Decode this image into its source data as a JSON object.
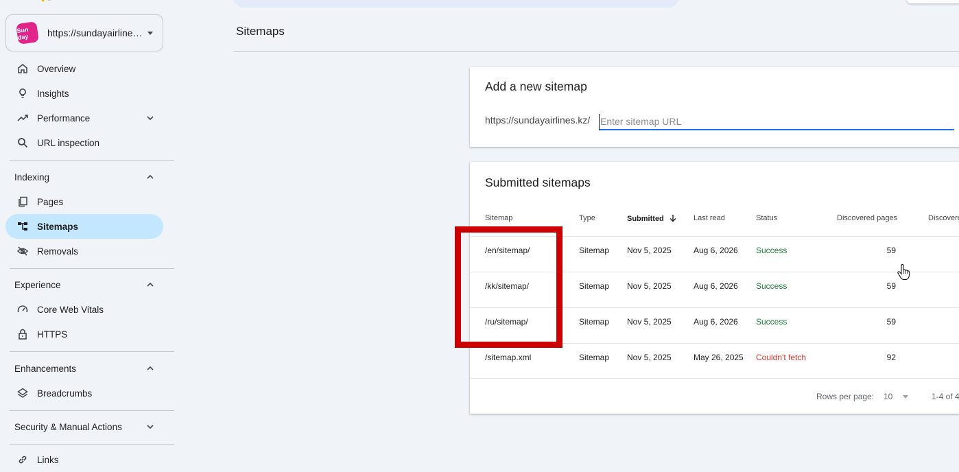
{
  "property": {
    "url": "https://sundayairlines.kz/",
    "avatar_text": "Sun day"
  },
  "nav": {
    "overview": "Overview",
    "insights": "Insights",
    "performance": "Performance",
    "url_inspection": "URL inspection",
    "indexing": "Indexing",
    "pages": "Pages",
    "sitemaps": "Sitemaps",
    "removals": "Removals",
    "experience": "Experience",
    "core_web_vitals": "Core Web Vitals",
    "https": "HTTPS",
    "enhancements": "Enhancements",
    "breadcrumbs": "Breadcrumbs",
    "security": "Security & Manual Actions",
    "links": "Links"
  },
  "page": {
    "title": "Sitemaps"
  },
  "add_card": {
    "title": "Add a new sitemap",
    "prefix": "https://sundayairlines.kz/",
    "placeholder": "Enter sitemap URL"
  },
  "submitted": {
    "title": "Submitted sitemaps",
    "headers": {
      "sitemap": "Sitemap",
      "type": "Type",
      "submitted": "Submitted",
      "last_read": "Last read",
      "status": "Status",
      "discovered_pages": "Discovered pages",
      "discovered_videos": "Discovere"
    },
    "rows": [
      {
        "sitemap": "/en/sitemap/",
        "type": "Sitemap",
        "submitted": "Nov 5, 2025",
        "last_read": "Aug 6, 2026",
        "status": "Success",
        "pages": "59"
      },
      {
        "sitemap": "/kk/sitemap/",
        "type": "Sitemap",
        "submitted": "Nov 5, 2025",
        "last_read": "Aug 6, 2026",
        "status": "Success",
        "pages": "59"
      },
      {
        "sitemap": "/ru/sitemap/",
        "type": "Sitemap",
        "submitted": "Nov 5, 2025",
        "last_read": "Aug 6, 2026",
        "status": "Success",
        "pages": "59"
      },
      {
        "sitemap": "/sitemap.xml",
        "type": "Sitemap",
        "submitted": "Nov 5, 2025",
        "last_read": "May 26, 2025",
        "status": "Couldn't fetch",
        "pages": "92"
      }
    ],
    "footer": {
      "rows_label": "Rows per page:",
      "rows_value": "10",
      "range": "1-4 of 4"
    }
  },
  "colors": {
    "active_nav": "#c2e7ff",
    "success": "#188038",
    "error": "#d93025",
    "highlight": "#cc0000",
    "focus": "#1a73e8"
  }
}
